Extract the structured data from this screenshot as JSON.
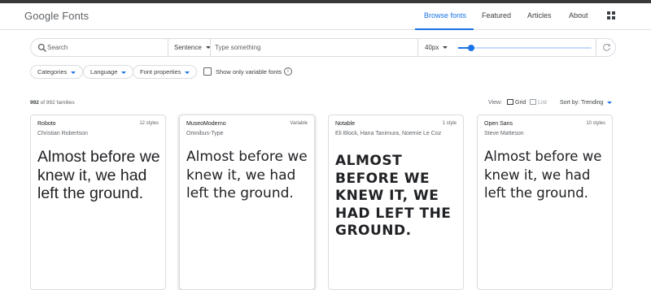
{
  "header": {
    "logo": "Google Fonts",
    "nav": [
      "Browse fonts",
      "Featured",
      "Articles",
      "About"
    ],
    "apps_icon": "apps-grid-icon"
  },
  "toolbar": {
    "search_placeholder": "Search",
    "preview_mode": "Sentence",
    "type_placeholder": "Type something",
    "font_size": "40px",
    "slider_level_fraction": 0.1
  },
  "filters": {
    "categories": "Categories",
    "language": "Language",
    "font_properties": "Font properties",
    "variable_label": "Show only variable fonts",
    "variable_checked": false,
    "info_icon": "i"
  },
  "results": {
    "count": "992",
    "count_suffix": "of 992 families",
    "view_label": "View:",
    "grid_label": "Grid",
    "list_label": "List",
    "sort": "Sort by: Trending"
  },
  "cards": [
    {
      "name": "Roboto",
      "author": "Christian Robertson",
      "meta": "12 styles",
      "sample": "Almost before we knew it, we had left the ground."
    },
    {
      "name": "MuseoModerno",
      "author": "Omnibus-Type",
      "meta": "Variable",
      "sample": "Almost before we knew it, we had left the ground."
    },
    {
      "name": "Notable",
      "author": "Eli Block, Hana Tanimura, Noemie Le Coz",
      "meta": "1 style",
      "sample": "Almost before we knew it, we had left the ground."
    },
    {
      "name": "Open Sans",
      "author": "Steve Matteson",
      "meta": "10 styles",
      "sample": "Almost before we knew it, we had left the ground."
    }
  ],
  "colors": {
    "accent": "#1a73e8",
    "text": "#3c4043",
    "muted": "#5f6368",
    "border": "#dadce0"
  }
}
